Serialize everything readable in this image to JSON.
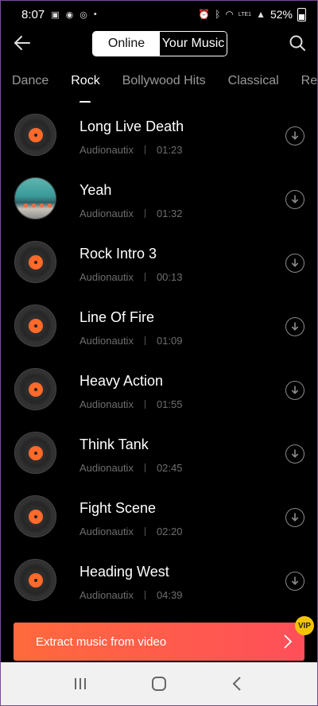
{
  "status_bar": {
    "time": "8:07",
    "battery": "52%",
    "network": "LTE1"
  },
  "header": {
    "segments": [
      "Online",
      "Your Music"
    ],
    "active_segment": "Online"
  },
  "tabs": [
    "Dance",
    "Rock",
    "Bollywood Hits",
    "Classical",
    "Regg"
  ],
  "active_tab": "Rock",
  "tracks": [
    {
      "title": "Long Live Death",
      "artist": "Audionautix",
      "duration": "01:23",
      "icon": "vinyl-disc-icon"
    },
    {
      "title": "Yeah",
      "artist": "Audionautix",
      "duration": "01:32",
      "icon": "album-photo"
    },
    {
      "title": "Rock Intro 3",
      "artist": "Audionautix",
      "duration": "00:13",
      "icon": "vinyl-disc-icon"
    },
    {
      "title": "Line Of Fire",
      "artist": "Audionautix",
      "duration": "01:09",
      "icon": "vinyl-disc-icon"
    },
    {
      "title": "Heavy Action",
      "artist": "Audionautix",
      "duration": "01:55",
      "icon": "vinyl-disc-icon"
    },
    {
      "title": "Think Tank",
      "artist": "Audionautix",
      "duration": "02:45",
      "icon": "vinyl-disc-icon"
    },
    {
      "title": "Fight Scene",
      "artist": "Audionautix",
      "duration": "02:20",
      "icon": "vinyl-disc-icon"
    },
    {
      "title": "Heading West",
      "artist": "Audionautix",
      "duration": "04:39",
      "icon": "vinyl-disc-icon"
    }
  ],
  "banner": {
    "label": "Extract music from video",
    "badge": "VIP"
  },
  "colors": {
    "accent": "#ff6a2a",
    "banner_start": "#ff6a3c",
    "banner_end": "#ff4f5a",
    "vip": "#f5c400"
  }
}
